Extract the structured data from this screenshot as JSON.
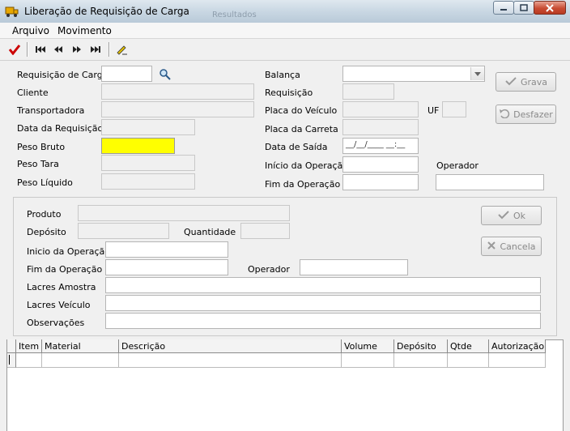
{
  "window": {
    "title": "Liberação de Requisição de Carga",
    "ghost_text": "Resultados"
  },
  "menu": {
    "items": [
      "Arquivo",
      "Movimento"
    ]
  },
  "toolbar": {
    "icons": [
      "checkmark-icon",
      "first-record-icon",
      "previous-record-icon",
      "next-record-icon",
      "last-record-icon",
      "edit-pencil-icon"
    ]
  },
  "header_form": {
    "requisicao_label": "Requisição de Carga",
    "cliente_label": "Cliente",
    "transportadora_label": "Transportadora",
    "data_requisicao_label": "Data da Requisição",
    "peso_bruto_label": "Peso Bruto",
    "peso_tara_label": "Peso Tara",
    "peso_liquido_label": "Peso Líquido",
    "balanca_label": "Balança",
    "requisicao2_label": "Requisição",
    "placa_veiculo_label": "Placa do Veículo",
    "uf_label": "UF",
    "placa_carreta_label": "Placa da Carreta",
    "data_saida_label": "Data de Saída",
    "data_saida_value": "__/__/____ __:__",
    "inicio_operacao_label": "Início da Operação",
    "fim_operacao_label": "Fim da Operação",
    "operador_label": "Operador",
    "grava_label": "Grava",
    "desfazer_label": "Desfazer"
  },
  "item_form": {
    "produto_label": "Produto",
    "deposito_label": "Depósito",
    "quantidade_label": "Quantidade",
    "inicio_operacao_label": "Inicio da Operação",
    "fim_operacao_label": "Fim da Operação",
    "operador_label": "Operador",
    "lacres_amostra_label": "Lacres Amostra",
    "lacres_veiculo_label": "Lacres Veículo",
    "observacoes_label": "Observações",
    "ok_label": "Ok",
    "cancela_label": "Cancela"
  },
  "grid": {
    "columns": [
      "Item",
      "Material",
      "Descrição",
      "Volume",
      "Depósito",
      "Qtde",
      "Autorização"
    ]
  },
  "colors": {
    "highlight": "#ffff00",
    "check_red": "#cc0000"
  }
}
